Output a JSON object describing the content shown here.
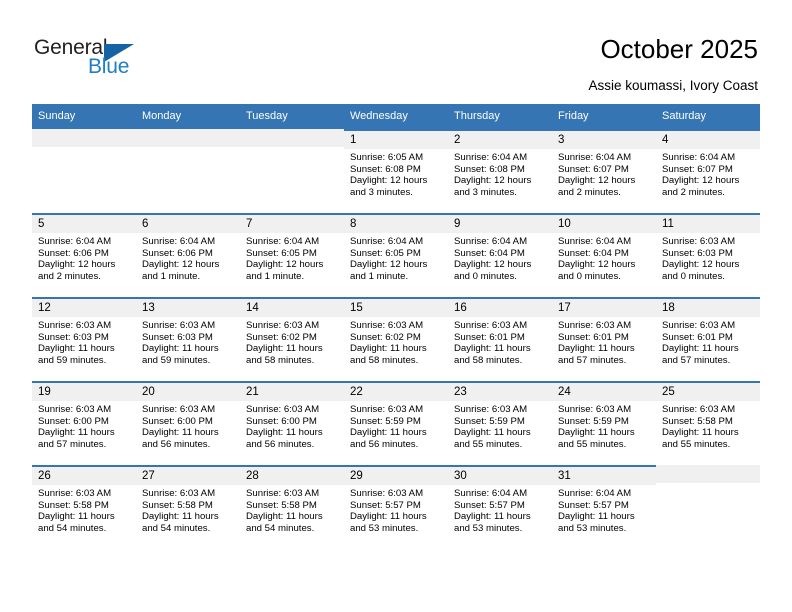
{
  "brand": {
    "name_top": "General",
    "name_bottom": "Blue",
    "color_dark": "#231f20",
    "color_blue": "#1f7fc4",
    "triangle_color": "#1464a5"
  },
  "header": {
    "title": "October 2025",
    "subtitle": "Assie koumassi, Ivory Coast"
  },
  "theme": {
    "header_bg": "#3575b3",
    "daynum_bg": "#f0f0f0",
    "cell_border": "#3575b3"
  },
  "weekdays": [
    "Sunday",
    "Monday",
    "Tuesday",
    "Wednesday",
    "Thursday",
    "Friday",
    "Saturday"
  ],
  "weeks": [
    [
      {
        "day": "",
        "sunrise": "",
        "sunset": "",
        "daylight_line1": "",
        "daylight_line2": ""
      },
      {
        "day": "",
        "sunrise": "",
        "sunset": "",
        "daylight_line1": "",
        "daylight_line2": ""
      },
      {
        "day": "",
        "sunrise": "",
        "sunset": "",
        "daylight_line1": "",
        "daylight_line2": ""
      },
      {
        "day": "1",
        "sunrise": "Sunrise: 6:05 AM",
        "sunset": "Sunset: 6:08 PM",
        "daylight_line1": "Daylight: 12 hours",
        "daylight_line2": "and 3 minutes."
      },
      {
        "day": "2",
        "sunrise": "Sunrise: 6:04 AM",
        "sunset": "Sunset: 6:08 PM",
        "daylight_line1": "Daylight: 12 hours",
        "daylight_line2": "and 3 minutes."
      },
      {
        "day": "3",
        "sunrise": "Sunrise: 6:04 AM",
        "sunset": "Sunset: 6:07 PM",
        "daylight_line1": "Daylight: 12 hours",
        "daylight_line2": "and 2 minutes."
      },
      {
        "day": "4",
        "sunrise": "Sunrise: 6:04 AM",
        "sunset": "Sunset: 6:07 PM",
        "daylight_line1": "Daylight: 12 hours",
        "daylight_line2": "and 2 minutes."
      }
    ],
    [
      {
        "day": "5",
        "sunrise": "Sunrise: 6:04 AM",
        "sunset": "Sunset: 6:06 PM",
        "daylight_line1": "Daylight: 12 hours",
        "daylight_line2": "and 2 minutes."
      },
      {
        "day": "6",
        "sunrise": "Sunrise: 6:04 AM",
        "sunset": "Sunset: 6:06 PM",
        "daylight_line1": "Daylight: 12 hours",
        "daylight_line2": "and 1 minute."
      },
      {
        "day": "7",
        "sunrise": "Sunrise: 6:04 AM",
        "sunset": "Sunset: 6:05 PM",
        "daylight_line1": "Daylight: 12 hours",
        "daylight_line2": "and 1 minute."
      },
      {
        "day": "8",
        "sunrise": "Sunrise: 6:04 AM",
        "sunset": "Sunset: 6:05 PM",
        "daylight_line1": "Daylight: 12 hours",
        "daylight_line2": "and 1 minute."
      },
      {
        "day": "9",
        "sunrise": "Sunrise: 6:04 AM",
        "sunset": "Sunset: 6:04 PM",
        "daylight_line1": "Daylight: 12 hours",
        "daylight_line2": "and 0 minutes."
      },
      {
        "day": "10",
        "sunrise": "Sunrise: 6:04 AM",
        "sunset": "Sunset: 6:04 PM",
        "daylight_line1": "Daylight: 12 hours",
        "daylight_line2": "and 0 minutes."
      },
      {
        "day": "11",
        "sunrise": "Sunrise: 6:03 AM",
        "sunset": "Sunset: 6:03 PM",
        "daylight_line1": "Daylight: 12 hours",
        "daylight_line2": "and 0 minutes."
      }
    ],
    [
      {
        "day": "12",
        "sunrise": "Sunrise: 6:03 AM",
        "sunset": "Sunset: 6:03 PM",
        "daylight_line1": "Daylight: 11 hours",
        "daylight_line2": "and 59 minutes."
      },
      {
        "day": "13",
        "sunrise": "Sunrise: 6:03 AM",
        "sunset": "Sunset: 6:03 PM",
        "daylight_line1": "Daylight: 11 hours",
        "daylight_line2": "and 59 minutes."
      },
      {
        "day": "14",
        "sunrise": "Sunrise: 6:03 AM",
        "sunset": "Sunset: 6:02 PM",
        "daylight_line1": "Daylight: 11 hours",
        "daylight_line2": "and 58 minutes."
      },
      {
        "day": "15",
        "sunrise": "Sunrise: 6:03 AM",
        "sunset": "Sunset: 6:02 PM",
        "daylight_line1": "Daylight: 11 hours",
        "daylight_line2": "and 58 minutes."
      },
      {
        "day": "16",
        "sunrise": "Sunrise: 6:03 AM",
        "sunset": "Sunset: 6:01 PM",
        "daylight_line1": "Daylight: 11 hours",
        "daylight_line2": "and 58 minutes."
      },
      {
        "day": "17",
        "sunrise": "Sunrise: 6:03 AM",
        "sunset": "Sunset: 6:01 PM",
        "daylight_line1": "Daylight: 11 hours",
        "daylight_line2": "and 57 minutes."
      },
      {
        "day": "18",
        "sunrise": "Sunrise: 6:03 AM",
        "sunset": "Sunset: 6:01 PM",
        "daylight_line1": "Daylight: 11 hours",
        "daylight_line2": "and 57 minutes."
      }
    ],
    [
      {
        "day": "19",
        "sunrise": "Sunrise: 6:03 AM",
        "sunset": "Sunset: 6:00 PM",
        "daylight_line1": "Daylight: 11 hours",
        "daylight_line2": "and 57 minutes."
      },
      {
        "day": "20",
        "sunrise": "Sunrise: 6:03 AM",
        "sunset": "Sunset: 6:00 PM",
        "daylight_line1": "Daylight: 11 hours",
        "daylight_line2": "and 56 minutes."
      },
      {
        "day": "21",
        "sunrise": "Sunrise: 6:03 AM",
        "sunset": "Sunset: 6:00 PM",
        "daylight_line1": "Daylight: 11 hours",
        "daylight_line2": "and 56 minutes."
      },
      {
        "day": "22",
        "sunrise": "Sunrise: 6:03 AM",
        "sunset": "Sunset: 5:59 PM",
        "daylight_line1": "Daylight: 11 hours",
        "daylight_line2": "and 56 minutes."
      },
      {
        "day": "23",
        "sunrise": "Sunrise: 6:03 AM",
        "sunset": "Sunset: 5:59 PM",
        "daylight_line1": "Daylight: 11 hours",
        "daylight_line2": "and 55 minutes."
      },
      {
        "day": "24",
        "sunrise": "Sunrise: 6:03 AM",
        "sunset": "Sunset: 5:59 PM",
        "daylight_line1": "Daylight: 11 hours",
        "daylight_line2": "and 55 minutes."
      },
      {
        "day": "25",
        "sunrise": "Sunrise: 6:03 AM",
        "sunset": "Sunset: 5:58 PM",
        "daylight_line1": "Daylight: 11 hours",
        "daylight_line2": "and 55 minutes."
      }
    ],
    [
      {
        "day": "26",
        "sunrise": "Sunrise: 6:03 AM",
        "sunset": "Sunset: 5:58 PM",
        "daylight_line1": "Daylight: 11 hours",
        "daylight_line2": "and 54 minutes."
      },
      {
        "day": "27",
        "sunrise": "Sunrise: 6:03 AM",
        "sunset": "Sunset: 5:58 PM",
        "daylight_line1": "Daylight: 11 hours",
        "daylight_line2": "and 54 minutes."
      },
      {
        "day": "28",
        "sunrise": "Sunrise: 6:03 AM",
        "sunset": "Sunset: 5:58 PM",
        "daylight_line1": "Daylight: 11 hours",
        "daylight_line2": "and 54 minutes."
      },
      {
        "day": "29",
        "sunrise": "Sunrise: 6:03 AM",
        "sunset": "Sunset: 5:57 PM",
        "daylight_line1": "Daylight: 11 hours",
        "daylight_line2": "and 53 minutes."
      },
      {
        "day": "30",
        "sunrise": "Sunrise: 6:04 AM",
        "sunset": "Sunset: 5:57 PM",
        "daylight_line1": "Daylight: 11 hours",
        "daylight_line2": "and 53 minutes."
      },
      {
        "day": "31",
        "sunrise": "Sunrise: 6:04 AM",
        "sunset": "Sunset: 5:57 PM",
        "daylight_line1": "Daylight: 11 hours",
        "daylight_line2": "and 53 minutes."
      },
      {
        "day": "",
        "sunrise": "",
        "sunset": "",
        "daylight_line1": "",
        "daylight_line2": ""
      }
    ]
  ]
}
